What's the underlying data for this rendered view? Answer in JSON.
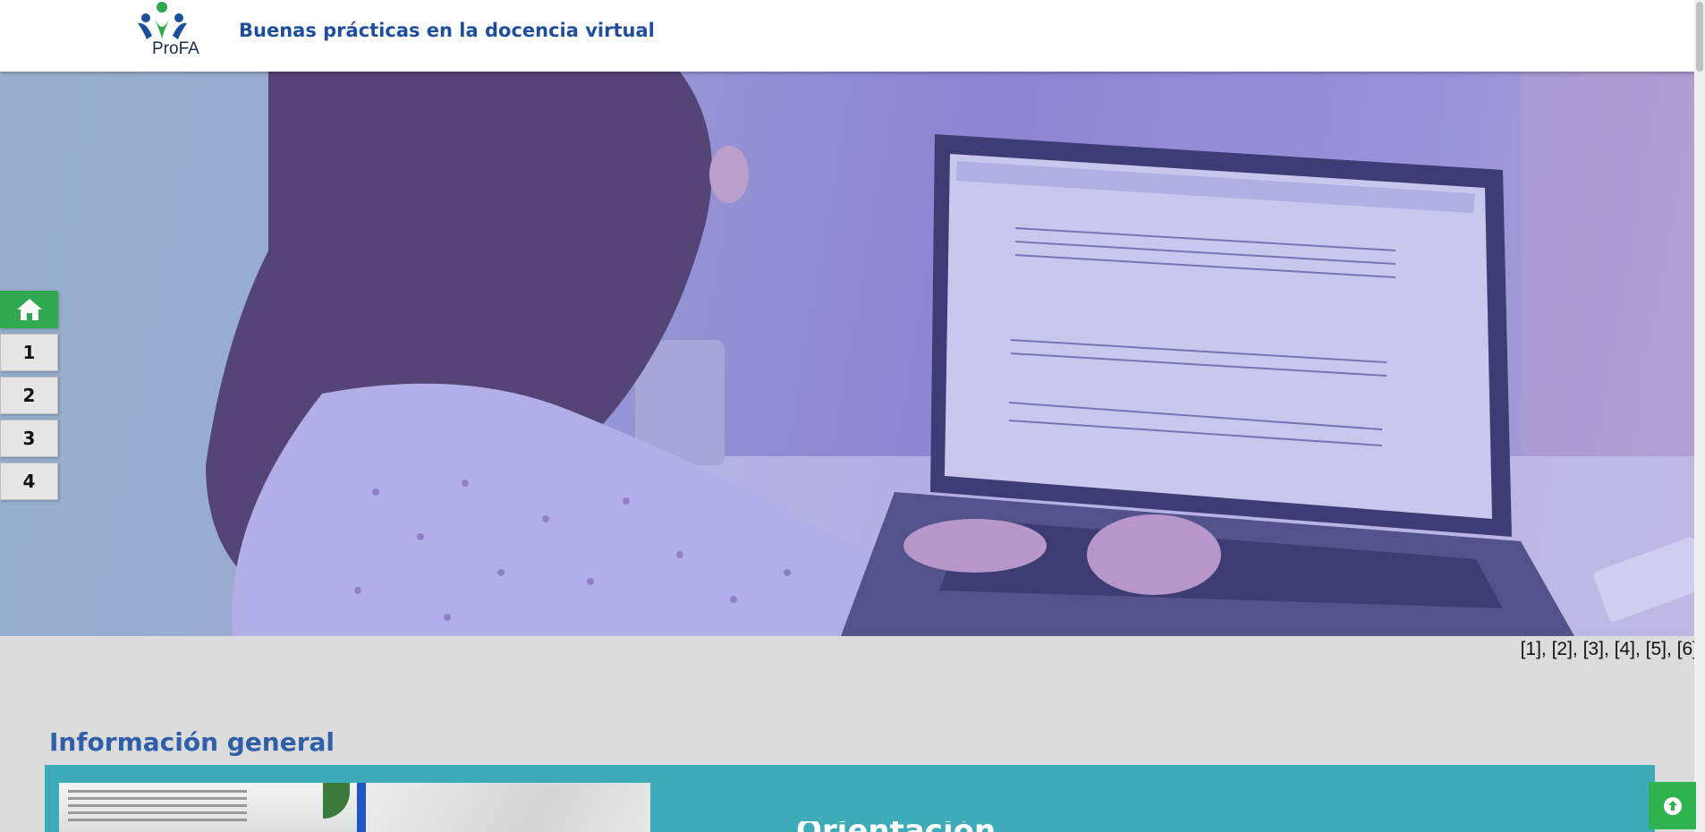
{
  "header": {
    "logo_text": "ProFA",
    "title": "Buenas prácticas en la docencia virtual"
  },
  "side_nav": {
    "home_icon": "home-icon",
    "items": [
      {
        "label": "1"
      },
      {
        "label": "2"
      },
      {
        "label": "3"
      },
      {
        "label": "4"
      }
    ]
  },
  "hero": {
    "credits": "[1], [2], [3], [4], [5], [6]"
  },
  "section": {
    "title": "Información general",
    "panel_heading": "Orientación"
  },
  "back_to_top": {
    "icon": "arrow-up-circle-icon"
  },
  "colors": {
    "brand_blue": "#1f4e9e",
    "section_blue": "#2f5fa8",
    "nav_green": "#2fa84f",
    "panel_teal": "#3eacb8"
  }
}
